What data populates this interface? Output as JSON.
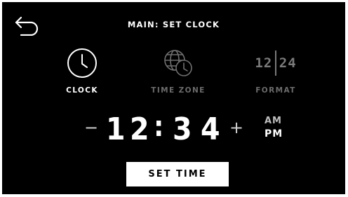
{
  "header": {
    "title": "MAIN: SET CLOCK",
    "back_icon": "back-arrow-icon"
  },
  "tabs": [
    {
      "label": "CLOCK",
      "icon": "clock-icon",
      "selected": true
    },
    {
      "label": "TIME ZONE",
      "icon": "globe-clock-icon",
      "selected": false
    },
    {
      "label": "FORMAT",
      "icon": "format-12-24-icon",
      "selected": false
    }
  ],
  "format_icon": {
    "left": "12",
    "right": "24"
  },
  "time": {
    "hour_tens": "1",
    "hour_ones": "2",
    "separator": ":",
    "minute_tens": "3",
    "minute_ones": "4",
    "decrement_label": "−",
    "increment_label": "+"
  },
  "meridiem": {
    "am": "AM",
    "pm": "PM",
    "selected": "PM"
  },
  "action": {
    "set_time_label": "SET TIME"
  },
  "colors": {
    "background": "#000000",
    "foreground": "#ffffff",
    "inactive": "#6b6b6b"
  }
}
